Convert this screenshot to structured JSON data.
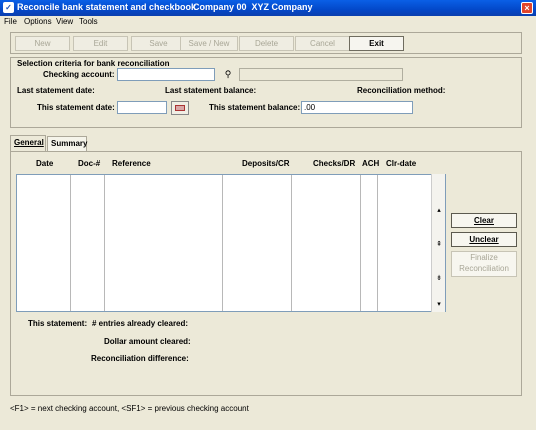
{
  "window": {
    "title": "Reconcile bank statement and checkbook",
    "company": "Company 00  XYZ Company",
    "close_label": "×"
  },
  "menu": [
    "File",
    "Options",
    "View",
    "Tools"
  ],
  "toolbar": {
    "new": "New",
    "edit": "Edit",
    "save": "Save",
    "save_new": "Save / New",
    "delete": "Delete",
    "cancel": "Cancel",
    "exit": "Exit"
  },
  "selection": {
    "group_title": "Selection criteria for bank reconciliation",
    "checking_account_label": "Checking account:",
    "checking_account_value": "",
    "account_name_value": "",
    "last_statement_date_label": "Last statement date:",
    "last_statement_balance_label": "Last statement balance:",
    "reconciliation_method_label": "Reconciliation method:",
    "this_statement_date_label": "This statement date:",
    "this_statement_date_value": "",
    "this_statement_balance_label": "This statement balance:",
    "this_statement_balance_value": ".00"
  },
  "tabs": [
    {
      "label": "General",
      "active": true
    },
    {
      "label": "Summary",
      "active": false
    }
  ],
  "grid": {
    "columns": [
      "Date",
      "Doc-#",
      "Reference",
      "Deposits/CR",
      "Checks/DR",
      "ACH",
      "Clr-date"
    ],
    "rows": []
  },
  "side_buttons": {
    "clear": "Clear",
    "unclear": "Unclear",
    "finalize": "Finalize Reconciliation"
  },
  "summary": {
    "this_statement_label": "This statement:",
    "entries_cleared_label": "# entries already cleared:",
    "dollar_cleared_label": "Dollar amount cleared:",
    "reconciliation_diff_label": "Reconciliation difference:"
  },
  "status": "<F1> = next checking account, <SF1> = previous checking account"
}
